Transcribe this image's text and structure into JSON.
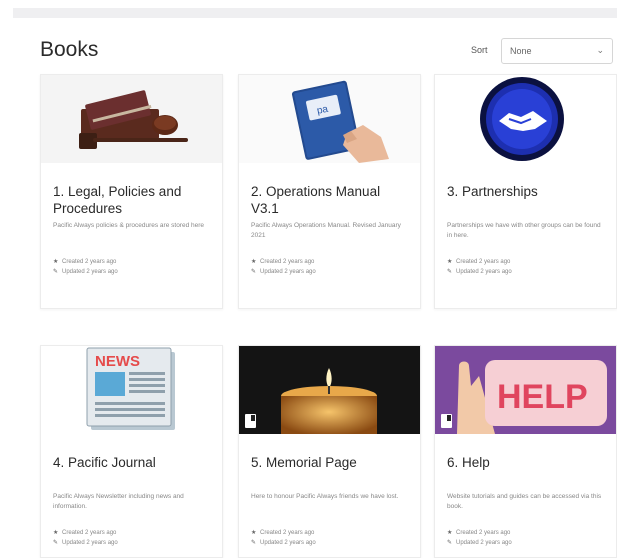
{
  "header": {
    "title": "Books"
  },
  "sort": {
    "label": "Sort",
    "selected": "None"
  },
  "books": [
    {
      "title": "1. Legal, Policies and Procedures",
      "description": "Pacific Always policies & procedures are stored here",
      "created": "Created 2 years ago",
      "updated": "Updated 2 years ago",
      "image": "gavel-and-law-book"
    },
    {
      "title": "2. Operations Manual V3.1",
      "description": "Pacific Always Operations Manual. Revised January 2021",
      "created": "Created 2 years ago",
      "updated": "Updated 2 years ago",
      "image": "blue-manual-in-hand"
    },
    {
      "title": "3. Partnerships",
      "description": "Partnerships we have with other groups can be found in here.",
      "created": "Created 2 years ago",
      "updated": "Updated 2 years ago",
      "image": "handshake-circle"
    },
    {
      "title": "4. Pacific Journal",
      "description": "Pacific Always Newsletter including news and information.",
      "created": "Created 2 years ago",
      "updated": "Updated 2 years ago",
      "image": "newspaper"
    },
    {
      "title": "5. Memorial Page",
      "description": "Here to honour Pacific Always friends we have lost.",
      "created": "Created 2 years ago",
      "updated": "Updated 2 years ago",
      "image": "candle"
    },
    {
      "title": "6. Help",
      "description": "Website tutorials and guides can be accessed via this book.",
      "created": "Created 2 years ago",
      "updated": "Updated 2 years ago",
      "image": "help-sign"
    }
  ],
  "images": {
    "news_label": "NEWS",
    "help_label": "HELP",
    "manual_label": "pa"
  },
  "icons": {
    "created": "star-icon",
    "updated": "pencil-icon",
    "sort_chevron": "chevron-down-icon"
  }
}
